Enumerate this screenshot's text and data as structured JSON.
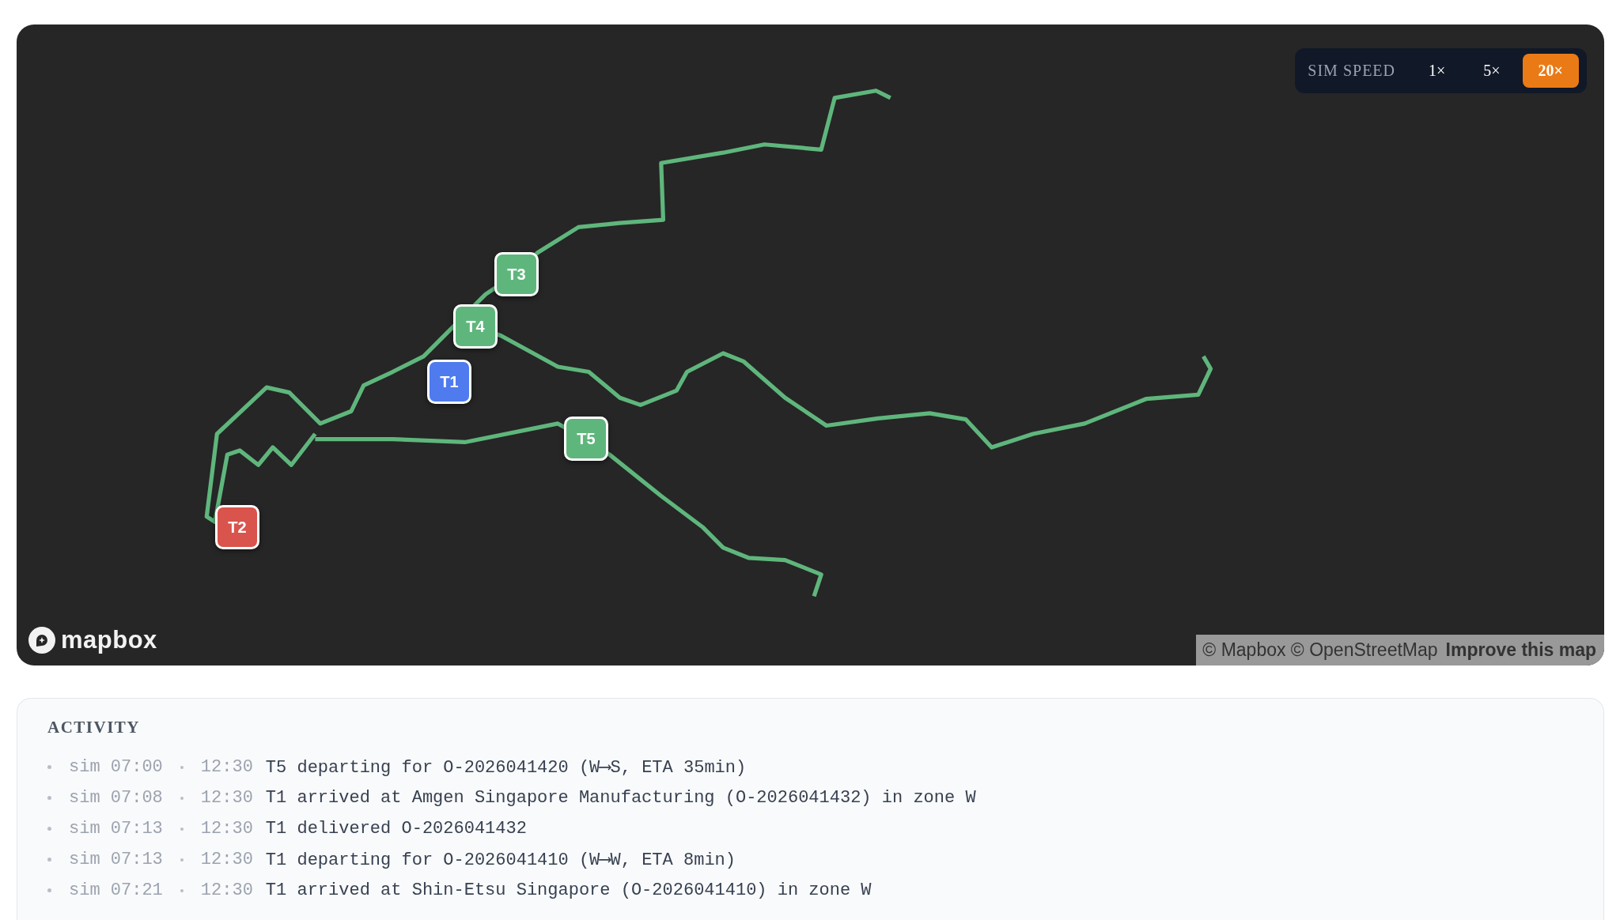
{
  "map": {
    "speed_control": {
      "label": "SIM SPEED",
      "options": [
        {
          "label": "1×",
          "selected": false
        },
        {
          "label": "5×",
          "selected": false
        },
        {
          "label": "20×",
          "selected": true
        }
      ]
    },
    "trucks": [
      {
        "label": "T3",
        "color": "#5fb67c"
      },
      {
        "label": "T4",
        "color": "#5fb67c"
      },
      {
        "label": "T1",
        "color": "#4f7bef"
      },
      {
        "label": "T5",
        "color": "#5fb67c"
      },
      {
        "label": "T2",
        "color": "#d9544c"
      }
    ],
    "logo": "mapbox",
    "attribution": {
      "text": "© Mapbox © OpenStreetMap",
      "link": "Improve this map"
    }
  },
  "activity": {
    "title": "ACTIVITY",
    "entries": [
      {
        "sim_time": "sim 07:00",
        "time": "12:30",
        "message": "T5 departing for O-2026041420 (W⟶S, ETA 35min)"
      },
      {
        "sim_time": "sim 07:08",
        "time": "12:30",
        "message": "T1 arrived at Amgen Singapore Manufacturing (O-2026041432) in zone W"
      },
      {
        "sim_time": "sim 07:13",
        "time": "12:30",
        "message": "T1 delivered O-2026041432"
      },
      {
        "sim_time": "sim 07:13",
        "time": "12:30",
        "message": "T1 departing for O-2026041410 (W⟶W, ETA 8min)"
      },
      {
        "sim_time": "sim 07:21",
        "time": "12:30",
        "message": "T1 arrived at Shin-Etsu Singapore (O-2026041410) in zone W"
      }
    ]
  }
}
